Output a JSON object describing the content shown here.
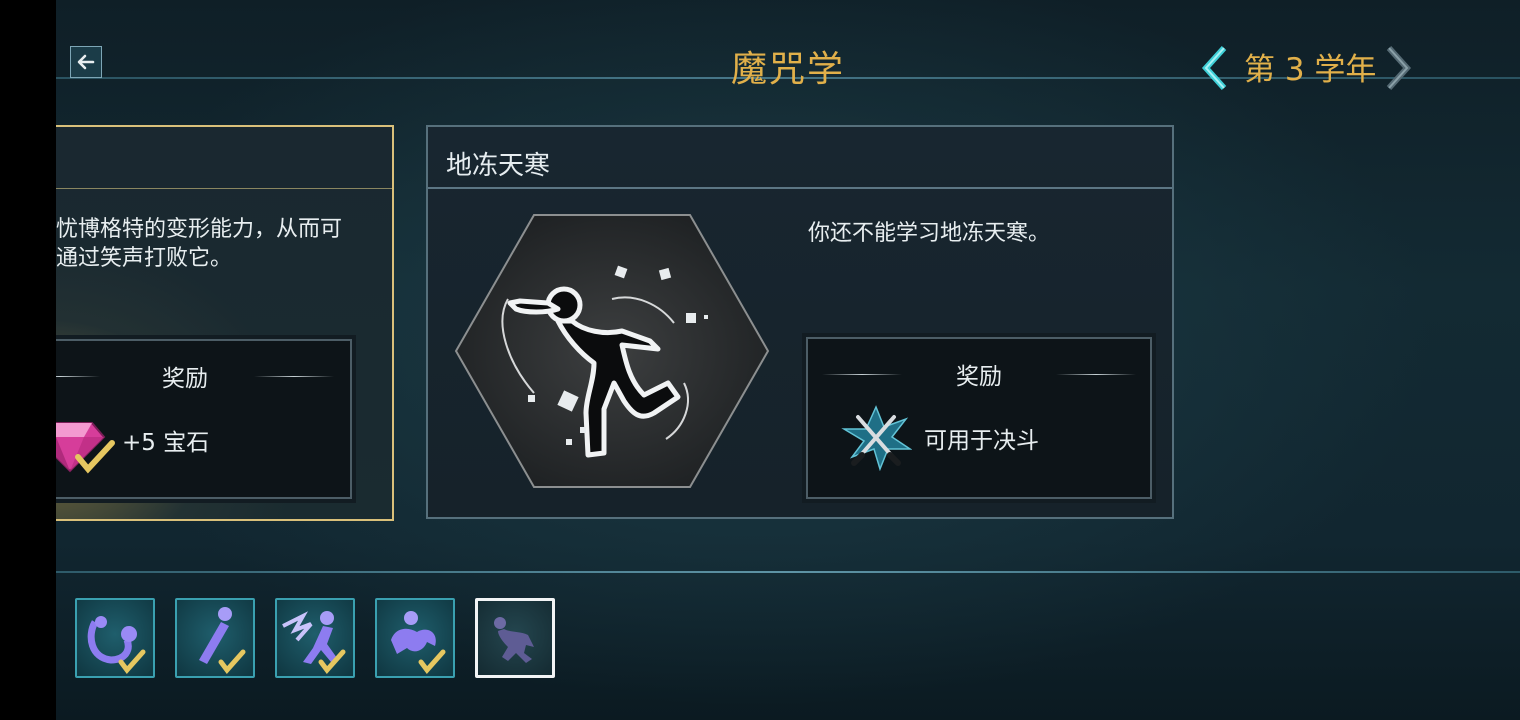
{
  "header": {
    "title": "魔咒学",
    "year_label": "第 3 学年"
  },
  "left_card": {
    "description": "忧博格特的变形能力，从而可\n通过笑声打败它。",
    "reward_header": "奖励",
    "reward_text": "+5 宝石"
  },
  "main_card": {
    "title": "地冻天寒",
    "description": "你还不能学习地冻天寒。",
    "reward_header": "奖励",
    "reward_text": "可用于决斗"
  },
  "spell_tabs": [
    {
      "icon": "riddikulus-spell-icon",
      "completed": true
    },
    {
      "icon": "stiff-figure-spell-icon",
      "completed": true
    },
    {
      "icon": "lightning-figure-spell-icon",
      "completed": true
    },
    {
      "icon": "tumbling-figure-spell-icon",
      "completed": true
    },
    {
      "icon": "frozen-figure-spell-icon",
      "completed": false,
      "selected": true
    }
  ],
  "colors": {
    "gold_text": "#e1b04a",
    "card_border_selected": "#d9c07a",
    "tab_border": "#3aa0b0",
    "check_mark": "#e6c760"
  }
}
